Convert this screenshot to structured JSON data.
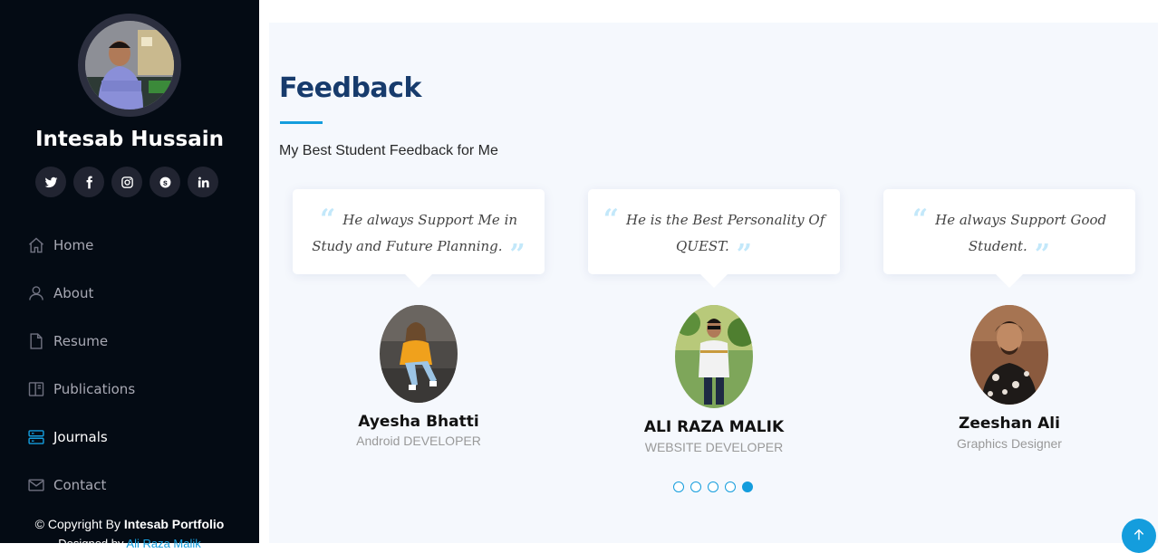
{
  "sidebar": {
    "owner_name": "Intesab Hussain",
    "social_icons": [
      "twitter-icon",
      "facebook-icon",
      "instagram-icon",
      "skype-icon",
      "linkedin-icon"
    ],
    "nav": [
      {
        "label": "Home",
        "icon": "home-icon",
        "active": false
      },
      {
        "label": "About",
        "icon": "user-icon",
        "active": false
      },
      {
        "label": "Resume",
        "icon": "file-icon",
        "active": false
      },
      {
        "label": "Publications",
        "icon": "book-icon",
        "active": false
      },
      {
        "label": "Journals",
        "icon": "server-icon",
        "active": true
      },
      {
        "label": "Contact",
        "icon": "envelope-icon",
        "active": false
      }
    ],
    "copyright_prefix": "© Copyright By ",
    "copyright_brand": "Intesab Portfolio",
    "designed_prefix": "Designed by ",
    "designed_link": "Ali Raza Malik"
  },
  "feedback": {
    "title": "Feedback",
    "subtitle": "My Best Student Feedback for Me",
    "testimonials": [
      {
        "quote": "He always Support Me in Study and Future Planning.",
        "name": "Ayesha Bhatti",
        "role": "Android DEVELOPER"
      },
      {
        "quote": "He is the Best Personality Of QUEST.",
        "name": "ALI RAZA MALIK",
        "role": "WEBSITE DEVELOPER"
      },
      {
        "quote": "He always Support Good Student.",
        "name": "Zeeshan Ali",
        "role": "Graphics Designer"
      }
    ],
    "pagination": {
      "total": 5,
      "active": 5
    }
  },
  "colors": {
    "accent": "#149ddd",
    "sidebar_bg": "#040b14",
    "title": "#173b6c",
    "section_bg": "#f5f8fd"
  }
}
